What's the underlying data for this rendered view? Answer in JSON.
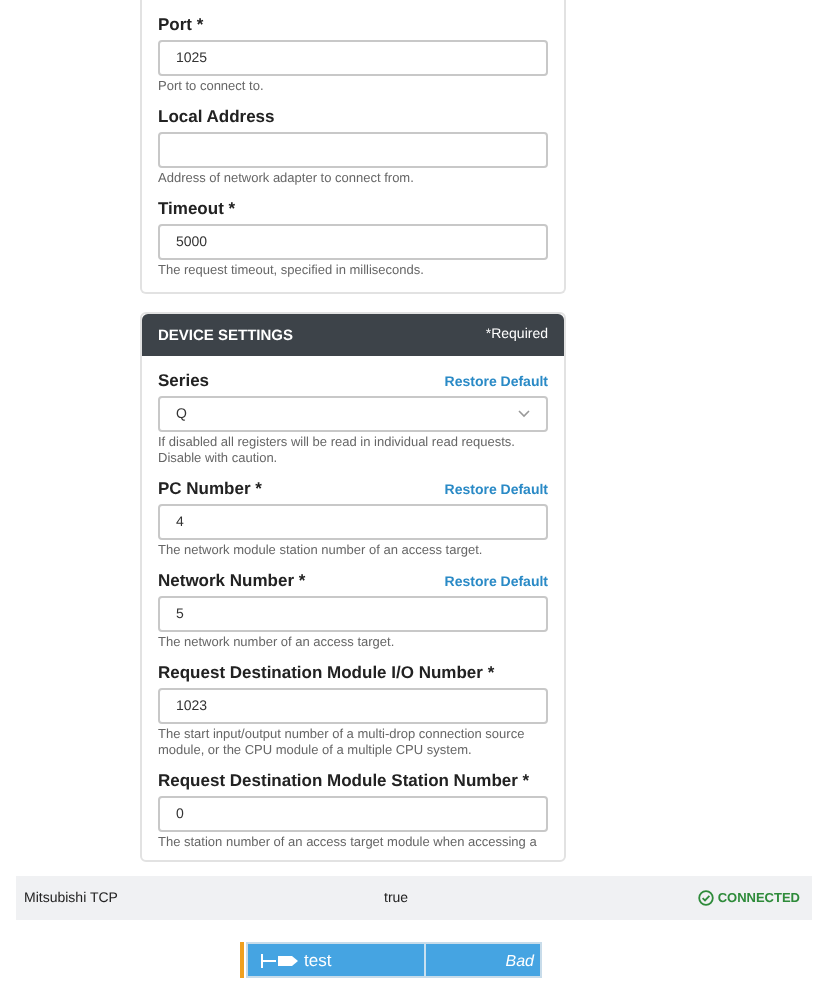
{
  "connection_fields": [
    {
      "kind": "text",
      "label": "Port *",
      "value": "1025",
      "hint": "Port to connect to."
    },
    {
      "kind": "text",
      "label": "Local Address",
      "hint": "Address of network adapter to connect from."
    },
    {
      "kind": "text",
      "label": "Timeout *",
      "value": "5000",
      "hint": "The request timeout, specified in milliseconds."
    }
  ],
  "device_settings": {
    "title": "DEVICE SETTINGS",
    "required_note": "*Required",
    "fields": [
      {
        "kind": "select",
        "label": "Series",
        "restore": "Restore Default",
        "value": "Q",
        "hint": "If disabled all registers will be read in individual read requests. Disable with caution."
      },
      {
        "kind": "text",
        "label": "PC Number *",
        "restore": "Restore Default",
        "value": "4",
        "hint": "The network module station number of an access target."
      },
      {
        "kind": "text",
        "label": "Network Number *",
        "restore": "Restore Default",
        "value": "5",
        "hint": "The network number of an access target."
      },
      {
        "kind": "text",
        "label": "Request Destination Module I/O Number *",
        "value": "1023",
        "hint": "The start input/output number of a multi-drop connection source module, or the CPU module of a multiple CPU system."
      },
      {
        "kind": "text",
        "label": "Request Destination Module Station Number *",
        "value": "0",
        "hint": "The station number of an access target module when accessing a"
      }
    ]
  },
  "device_row": {
    "name": "Mitsubishi TCP",
    "enabled": "true",
    "status": "CONNECTED"
  },
  "tag": {
    "name": "test",
    "quality": "Bad"
  }
}
